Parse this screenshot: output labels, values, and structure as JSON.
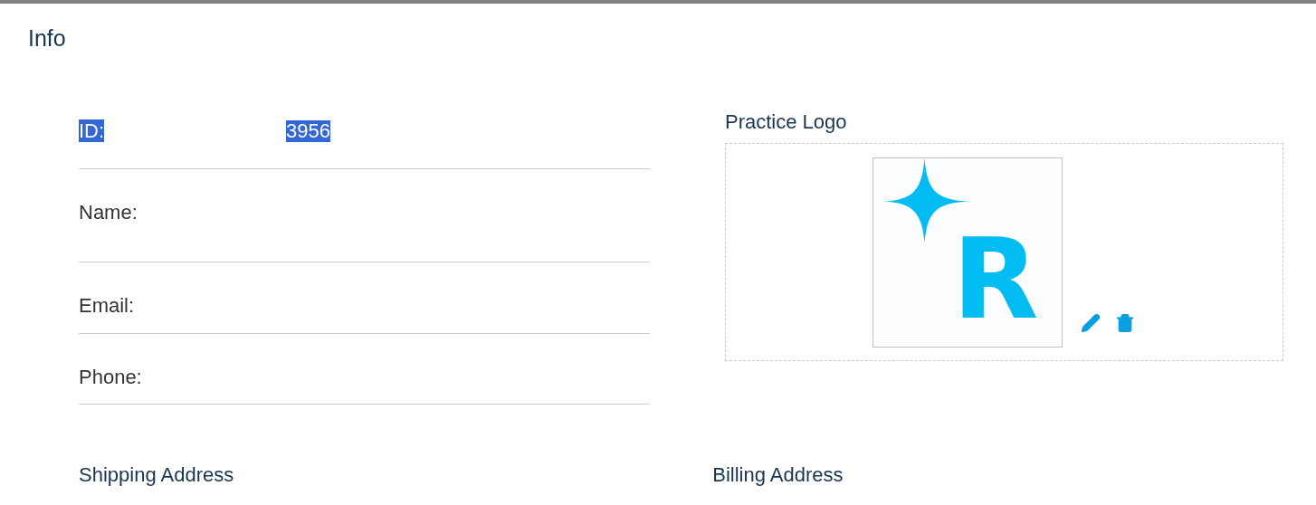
{
  "section_title": "Info",
  "fields": [
    {
      "label": "ID:",
      "value": "3956",
      "highlighted": true
    },
    {
      "label": "Name:",
      "highlighted": false
    },
    {
      "label": "Email:",
      "highlighted": false
    },
    {
      "label": "Phone:",
      "highlighted": false
    }
  ],
  "logo": {
    "title": "Practice Logo",
    "logo_letter": "R"
  },
  "addresses": [
    "Shipping Address",
    "Billing Address"
  ]
}
